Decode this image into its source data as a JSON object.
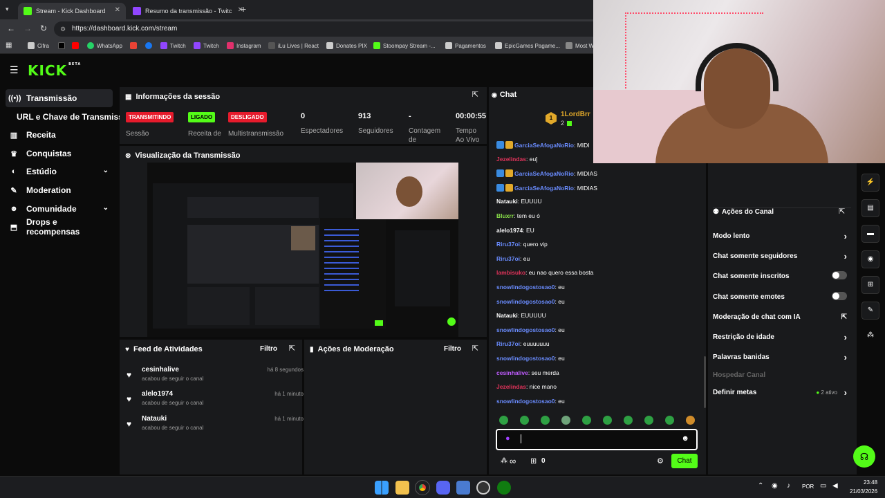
{
  "browser": {
    "tabs": [
      {
        "label": "Stream - Kick Dashboard",
        "active": true
      },
      {
        "label": "Resumo da transmissão - Twitc",
        "active": false
      }
    ],
    "new_tab": "+",
    "url": "https://dashboard.kick.com/stream",
    "bookmarks": [
      "Cifra",
      "WhatsApp",
      "Twitch",
      "Twitch",
      "Instagram",
      "iLu Lives | React",
      "Donates PIX",
      "Stoompay Stream -...",
      "Pagamentos",
      "EpicGames Pagame...",
      "Most W"
    ]
  },
  "kick": {
    "logo": "KICK",
    "logo_tag": "BETA",
    "sidebar": [
      {
        "label": "Transmissão",
        "icon": "broadcast-icon",
        "active": true
      },
      {
        "label": "URL e Chave de Transmissão",
        "icon": "",
        "active": false
      },
      {
        "label": "Receita",
        "icon": "revenue-icon",
        "active": false
      },
      {
        "label": "Conquistas",
        "icon": "trophy-icon",
        "active": false
      },
      {
        "label": "Estúdio",
        "icon": "studio-icon",
        "active": false,
        "chevron": true
      },
      {
        "label": "Moderation",
        "icon": "wrench-icon",
        "active": false
      },
      {
        "label": "Comunidade",
        "icon": "community-icon",
        "active": false,
        "chevron": true
      },
      {
        "label": "Drops e recompensas",
        "icon": "drops-icon",
        "active": false
      }
    ],
    "session": {
      "title": "Informações da sessão",
      "badges": [
        {
          "text": "TRANSMITINDO",
          "color": "#e61b2c",
          "label": "Sessão"
        },
        {
          "text": "LIGADO",
          "color": "#53fc18",
          "label": "Receita de"
        },
        {
          "text": "DESLIGADO",
          "color": "#e61b2c",
          "label": "Multistransmissão"
        }
      ],
      "stats": [
        {
          "value": "0",
          "label": "Espectadores"
        },
        {
          "value": "913",
          "label": "Seguidores"
        },
        {
          "value": "-",
          "label": "Contagem de"
        },
        {
          "value": "00:00:55",
          "label": "Tempo Ao Vivo"
        }
      ]
    },
    "preview": {
      "title": "Visualização da Transmissão"
    },
    "feed": {
      "title": "Feed de Atividades",
      "filter": "Filtro",
      "items": [
        {
          "name": "cesinhalive",
          "sub": "acabou de seguir o canal",
          "time": "há 8 segundos"
        },
        {
          "name": "alelo1974",
          "sub": "acabou de seguir o canal",
          "time": "há 1 minuto"
        },
        {
          "name": "Natauki",
          "sub": "acabou de seguir o canal",
          "time": "há 1 minuto"
        }
      ]
    },
    "moderation": {
      "title": "Ações de Moderação",
      "filter": "Filtro"
    },
    "chat": {
      "title": "Chat",
      "pinned_user": "1LordBrr",
      "pinned_count": "2",
      "messages": [
        {
          "user": "GarciaSeAfogaNoRio",
          "text": ": MIDI",
          "color": "#6a8cff",
          "badges": true
        },
        {
          "user": "Jezelindas",
          "text": ": eu]",
          "color": "#e0335a",
          "badges": false
        },
        {
          "user": "GarciaSeAfogaNoRio",
          "text": ": MIDIAS",
          "color": "#6a8cff",
          "badges": true
        },
        {
          "user": "GarciaSeAfogaNoRio",
          "text": ": MIDIAS",
          "color": "#6a8cff",
          "badges": true
        },
        {
          "user": "Natauki",
          "text": ": EUUUU",
          "color": "#ffffff",
          "badges": false
        },
        {
          "user": "Bluxrr",
          "text": ": tem eu ó",
          "color": "#8be34a",
          "badges": false
        },
        {
          "user": "alelo1974",
          "text": ": EU",
          "color": "#ffffff",
          "badges": false
        },
        {
          "user": "Riru37oi",
          "text": ": quero vip",
          "color": "#6a8cff",
          "badges": false
        },
        {
          "user": "Riru37oi",
          "text": ": eu",
          "color": "#6a8cff",
          "badges": false
        },
        {
          "user": "lambisuko",
          "text": ": eu nao quero essa bosta",
          "color": "#e0335a",
          "badges": false
        },
        {
          "user": "snowlindogostosao0",
          "text": ": eu",
          "color": "#6a8cff",
          "badges": false
        },
        {
          "user": "snowlindogostosao0",
          "text": ": eu",
          "color": "#6a8cff",
          "badges": false
        },
        {
          "user": "Natauki",
          "text": ": EUUUUU",
          "color": "#ffffff",
          "badges": false
        },
        {
          "user": "snowlindogostosao0",
          "text": ": eu",
          "color": "#6a8cff",
          "badges": false
        },
        {
          "user": "Riru37oi",
          "text": ": euuuuuuu",
          "color": "#6a8cff",
          "badges": false
        },
        {
          "user": "snowlindogostosao0",
          "text": ": eu",
          "color": "#6a8cff",
          "badges": false
        },
        {
          "user": "cesinhalive",
          "text": ": seu merda",
          "color": "#c05cff",
          "badges": false
        },
        {
          "user": "Jezelindas",
          "text": ": nice mano",
          "color": "#e0335a",
          "badges": false
        },
        {
          "user": "snowlindogostosao0",
          "text": ": eu",
          "color": "#6a8cff",
          "badges": false
        }
      ],
      "input_value": "",
      "infinite": "∞",
      "points": "0",
      "send_label": "Chat"
    },
    "channel_actions": {
      "title": "Ações do Canal",
      "items": [
        {
          "label": "Modo lento",
          "type": "chevron"
        },
        {
          "label": "Chat somente seguidores",
          "type": "chevron"
        },
        {
          "label": "Chat somente inscritos",
          "type": "toggle"
        },
        {
          "label": "Chat somente emotes",
          "type": "toggle"
        },
        {
          "label": "Moderação de chat com IA",
          "type": "external"
        },
        {
          "label": "Restrição de idade",
          "type": "chevron"
        },
        {
          "label": "Palavras banidas",
          "type": "chevron"
        },
        {
          "label": "Hospedar Canal",
          "type": "disabled"
        },
        {
          "label": "Definir metas",
          "type": "chevron",
          "extra": "2 ativo"
        }
      ]
    }
  },
  "taskbar": {
    "lang": "POR",
    "time": "23:48",
    "date": "21/03/2026"
  },
  "colors": {
    "accent": "#53fc18",
    "live": "#e61b2c",
    "panel": "#191a1c"
  }
}
